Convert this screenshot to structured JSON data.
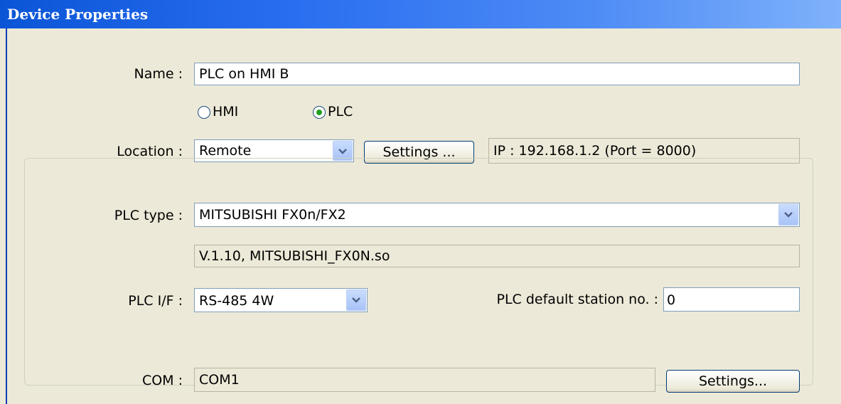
{
  "window": {
    "title": "Device Properties"
  },
  "name": {
    "label": "Name :",
    "value": "PLC on HMI B"
  },
  "type_radio": {
    "options": [
      {
        "label": "HMI",
        "selected": false
      },
      {
        "label": "PLC",
        "selected": true
      }
    ]
  },
  "location": {
    "label": "Location :",
    "value": "Remote",
    "settings_label": "Settings ...",
    "ip_info": "IP : 192.168.1.2 (Port = 8000)"
  },
  "plc": {
    "type_label": "PLC type :",
    "type_value": "MITSUBISHI FX0n/FX2",
    "driver_info": "V.1.10, MITSUBISHI_FX0N.so",
    "if_label": "PLC I/F :",
    "if_value": "RS-485 4W",
    "station_label": "PLC default station no. :",
    "station_value": "0"
  },
  "com": {
    "label": "COM :",
    "value": "COM1",
    "settings_label": "Settings..."
  },
  "colors": {
    "titlebar_start": "#0a55d6",
    "dialog_bg": "#ece9d8",
    "radio_dot": "#21a121"
  }
}
